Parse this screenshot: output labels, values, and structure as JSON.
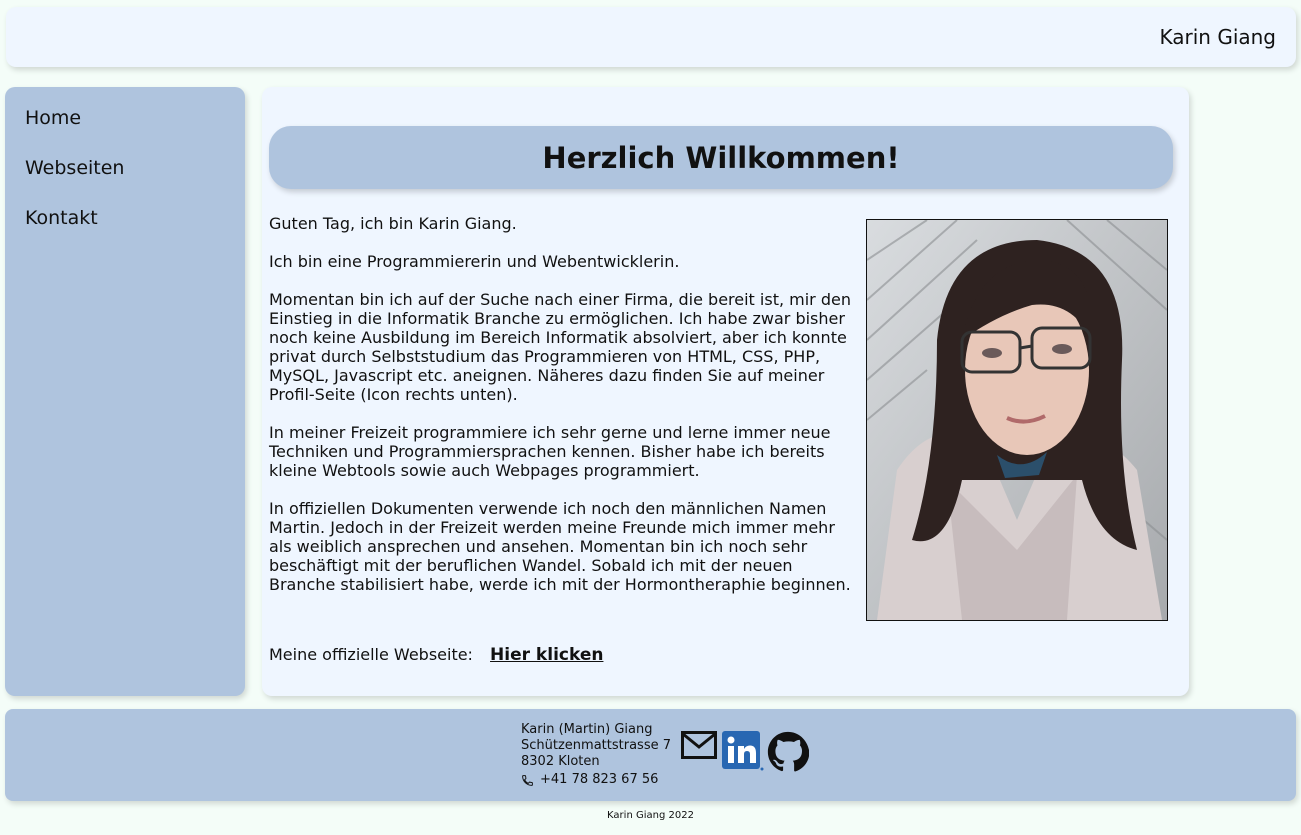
{
  "header": {
    "name": "Karin Giang"
  },
  "sidebar": {
    "items": [
      {
        "label": "Home"
      },
      {
        "label": "Webseiten"
      },
      {
        "label": "Kontakt"
      }
    ]
  },
  "main": {
    "title": "Herzlich Willkommen!",
    "paragraphs": [
      "Guten Tag, ich bin Karin Giang.",
      "Ich bin eine Programmiererin und Webentwicklerin.",
      "Momentan bin ich auf der Suche nach einer Firma, die bereit ist, mir den Einstieg in die Informatik Branche zu ermöglichen. Ich habe zwar bisher noch keine Ausbildung im Bereich Informatik absolviert, aber ich konnte privat durch Selbststudium das Programmieren von HTML, CSS, PHP, MySQL, Javascript etc. aneignen. Näheres dazu finden Sie auf meiner Profil-Seite (Icon rechts unten).",
      "In meiner Freizeit programmiere ich sehr gerne und lerne immer neue Techniken und Programmiersprachen kennen. Bisher habe ich bereits kleine Webtools sowie auch Webpages programmiert.",
      "In offiziellen Dokumenten verwende ich noch den männlichen Namen Martin. Jedoch in der Freizeit werden meine Freunde mich immer mehr als weiblich ansprechen und ansehen. Momentan bin ich noch sehr beschäftigt mit der beruflichen Wandel. Sobald ich mit der neuen Branche stabilisiert habe, werde ich mit der Hormontheraphie beginnen."
    ],
    "website_label": "Meine offizielle Webseite:",
    "website_link": "Hier klicken"
  },
  "footer": {
    "name": "Karin (Martin) Giang",
    "street": "Schützenmattstrasse 7",
    "city": "8302 Kloten",
    "phone": "+41 78 823 67 56",
    "icons": [
      "mail-icon",
      "linkedin-icon",
      "github-icon"
    ],
    "copyright": "Karin Giang 2022"
  },
  "colors": {
    "background": "#f4fdf8",
    "panel_light": "#eff6ff",
    "panel_blue": "#afc4de",
    "linkedin": "#2867b2"
  }
}
